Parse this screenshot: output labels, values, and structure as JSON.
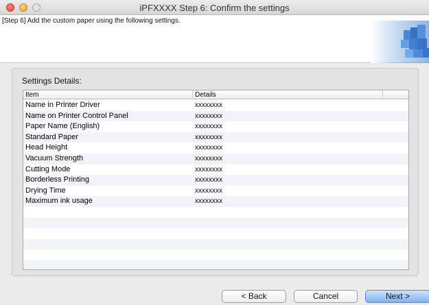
{
  "window": {
    "title": "iPFXXXX Step 6: Confirm the settings"
  },
  "header": {
    "step_text": "[Step 6] Add the custom paper using the following settings."
  },
  "settings": {
    "title": "Settings Details:",
    "columns": [
      "Item",
      "Details",
      ""
    ],
    "rows": [
      {
        "item": "Name in Printer Driver",
        "details": "xxxxxxxx"
      },
      {
        "item": "Name on Printer Control Panel",
        "details": "xxxxxxxx"
      },
      {
        "item": "Paper Name (English)",
        "details": "xxxxxxxx"
      },
      {
        "item": "Standard Paper",
        "details": "xxxxxxxx"
      },
      {
        "item": "Head Height",
        "details": "xxxxxxxx"
      },
      {
        "item": "Vacuum Strength",
        "details": "xxxxxxxx"
      },
      {
        "item": "Cutting Mode",
        "details": "xxxxxxxx"
      },
      {
        "item": "Borderless Printing",
        "details": "xxxxxxxx"
      },
      {
        "item": "Drying Time",
        "details": "xxxxxxxx"
      },
      {
        "item": "Maximum ink usage",
        "details": "xxxxxxxx"
      },
      {
        "item": "",
        "details": ""
      },
      {
        "item": "",
        "details": ""
      },
      {
        "item": "",
        "details": ""
      },
      {
        "item": "",
        "details": ""
      },
      {
        "item": "",
        "details": ""
      },
      {
        "item": "",
        "details": ""
      }
    ]
  },
  "buttons": {
    "back": "< Back",
    "cancel": "Cancel",
    "next": "Next >"
  },
  "colors": {
    "default_button": "#80b2ef",
    "row_stripe": "#f1f5fa"
  }
}
